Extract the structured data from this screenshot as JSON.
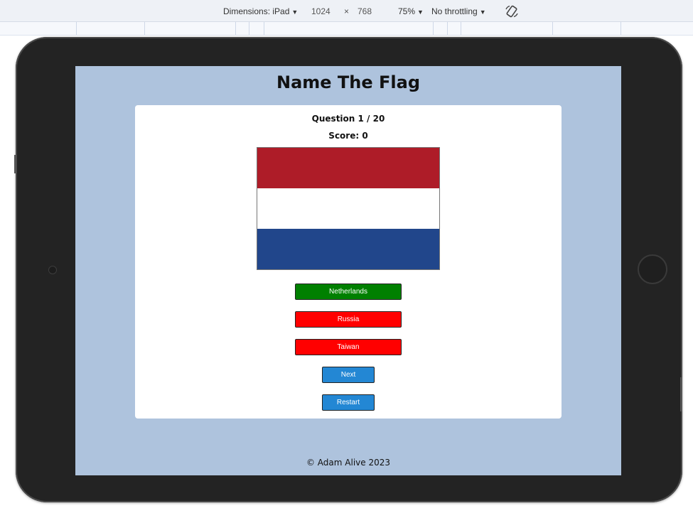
{
  "devtools": {
    "dimensions_label": "Dimensions: iPad",
    "width": "1024",
    "times": "×",
    "height": "768",
    "zoom": "75%",
    "throttling": "No throttling",
    "rotate_icon": "rotate-icon",
    "caret_icon": "caret-down-icon"
  },
  "quiz": {
    "title": "Name The Flag",
    "question_counter": "Question 1 / 20",
    "score": "Score: 0",
    "flag": {
      "name": "Netherlands flag",
      "stripes": [
        "#ae1c28",
        "#ffffff",
        "#21468b"
      ]
    },
    "answers": [
      {
        "label": "Netherlands",
        "color": "#008000"
      },
      {
        "label": "Russia",
        "color": "#ff0000"
      },
      {
        "label": "Taiwan",
        "color": "#ff0000"
      }
    ],
    "next_label": "Next",
    "restart_label": "Restart"
  },
  "footer": {
    "text": "© Adam Alive 2023"
  },
  "colors": {
    "page_background": "#aec3dd",
    "card_background": "#ffffff",
    "control_button": "#2387d4",
    "device_frame": "#232323"
  }
}
